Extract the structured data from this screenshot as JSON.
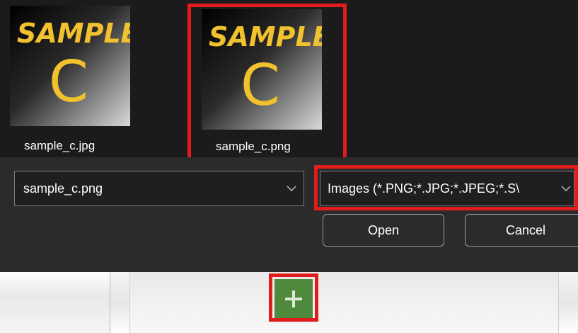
{
  "files": [
    {
      "name": "sample_c.jpg",
      "thumb_text_top": "SAMPLE",
      "thumb_text_big": "C"
    },
    {
      "name": "sample_c.png",
      "thumb_text_top": "SAMPLE",
      "thumb_text_big": "C"
    }
  ],
  "dialog": {
    "filename_value": "sample_c.png",
    "filetype_value": "Images (*.PNG;*.JPG;*.JPEG;*.S\\",
    "open_label": "Open",
    "cancel_label": "Cancel"
  },
  "icons": {
    "chevron": "chevron-down-icon",
    "plus": "plus-icon"
  },
  "colors": {
    "highlight": "#e01c1c",
    "add_button": "#4f8a3c",
    "thumb_ink": "#f2c12e"
  }
}
